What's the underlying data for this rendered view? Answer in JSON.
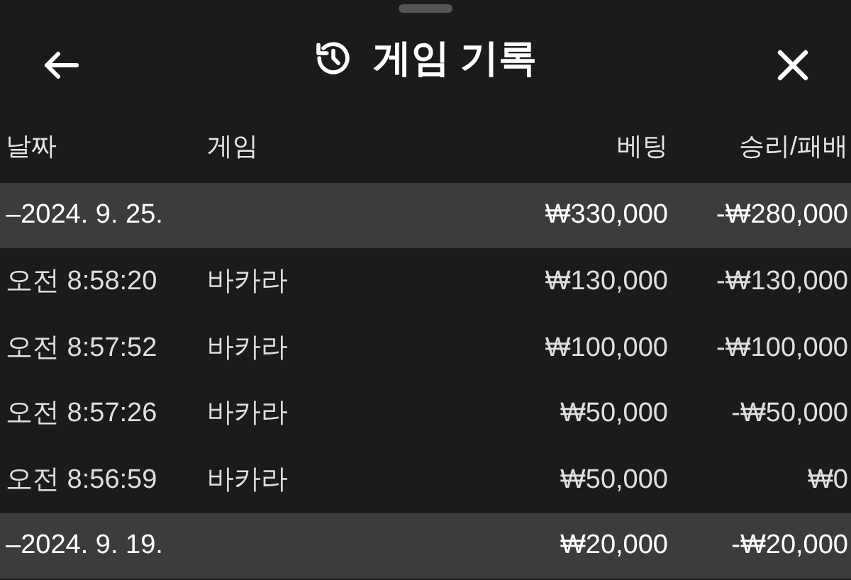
{
  "header": {
    "title": "게임 기록"
  },
  "columns": [
    "날짜",
    "게임",
    "베팅",
    "승리/패배"
  ],
  "rows": [
    {
      "kind": "group",
      "date": "–2024. 9. 25.",
      "bet": "₩330,000",
      "result": "-₩280,000"
    },
    {
      "kind": "item",
      "time": "오전 8:58:20",
      "game": "바카라",
      "bet": "₩130,000",
      "result": "-₩130,000"
    },
    {
      "kind": "item",
      "time": "오전 8:57:52",
      "game": "바카라",
      "bet": "₩100,000",
      "result": "-₩100,000"
    },
    {
      "kind": "item",
      "time": "오전 8:57:26",
      "game": "바카라",
      "bet": "₩50,000",
      "result": "-₩50,000"
    },
    {
      "kind": "item",
      "time": "오전 8:56:59",
      "game": "바카라",
      "bet": "₩50,000",
      "result": "₩0"
    },
    {
      "kind": "group",
      "date": "–2024. 9. 19.",
      "bet": "₩20,000",
      "result": "-₩20,000"
    }
  ]
}
